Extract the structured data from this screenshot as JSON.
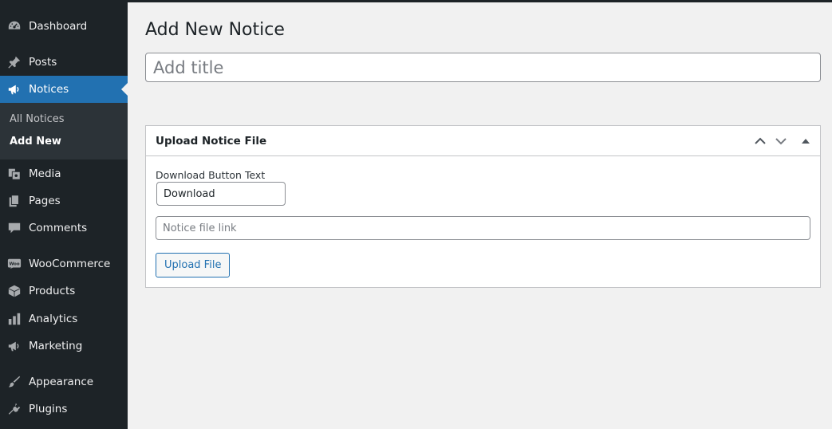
{
  "sidebar": {
    "items": [
      {
        "label": "Dashboard",
        "icon": "dashboard-icon"
      },
      {
        "label": "Posts",
        "icon": "pin-icon"
      },
      {
        "label": "Notices",
        "icon": "megaphone-icon",
        "current": true
      },
      {
        "label": "Media",
        "icon": "media-icon"
      },
      {
        "label": "Pages",
        "icon": "pages-icon"
      },
      {
        "label": "Comments",
        "icon": "comment-icon"
      },
      {
        "label": "WooCommerce",
        "icon": "woo-icon"
      },
      {
        "label": "Products",
        "icon": "box-icon"
      },
      {
        "label": "Analytics",
        "icon": "bar-chart-icon"
      },
      {
        "label": "Marketing",
        "icon": "megaphone-icon"
      },
      {
        "label": "Appearance",
        "icon": "brush-icon"
      },
      {
        "label": "Plugins",
        "icon": "plug-icon"
      }
    ],
    "submenu": [
      {
        "label": "All Notices"
      },
      {
        "label": "Add New",
        "active": true
      }
    ]
  },
  "main": {
    "title": "Add New Notice",
    "title_placeholder": "Add title"
  },
  "metabox": {
    "title": "Upload Notice File",
    "field_label": "Download Button Text",
    "button_text_value": "Download",
    "link_placeholder": "Notice file link",
    "upload_label": "Upload File"
  },
  "colors": {
    "sidebar_bg": "#1d2327",
    "submenu_bg": "#2c3338",
    "accent": "#2271b1",
    "page_bg": "#f1f1f1"
  }
}
